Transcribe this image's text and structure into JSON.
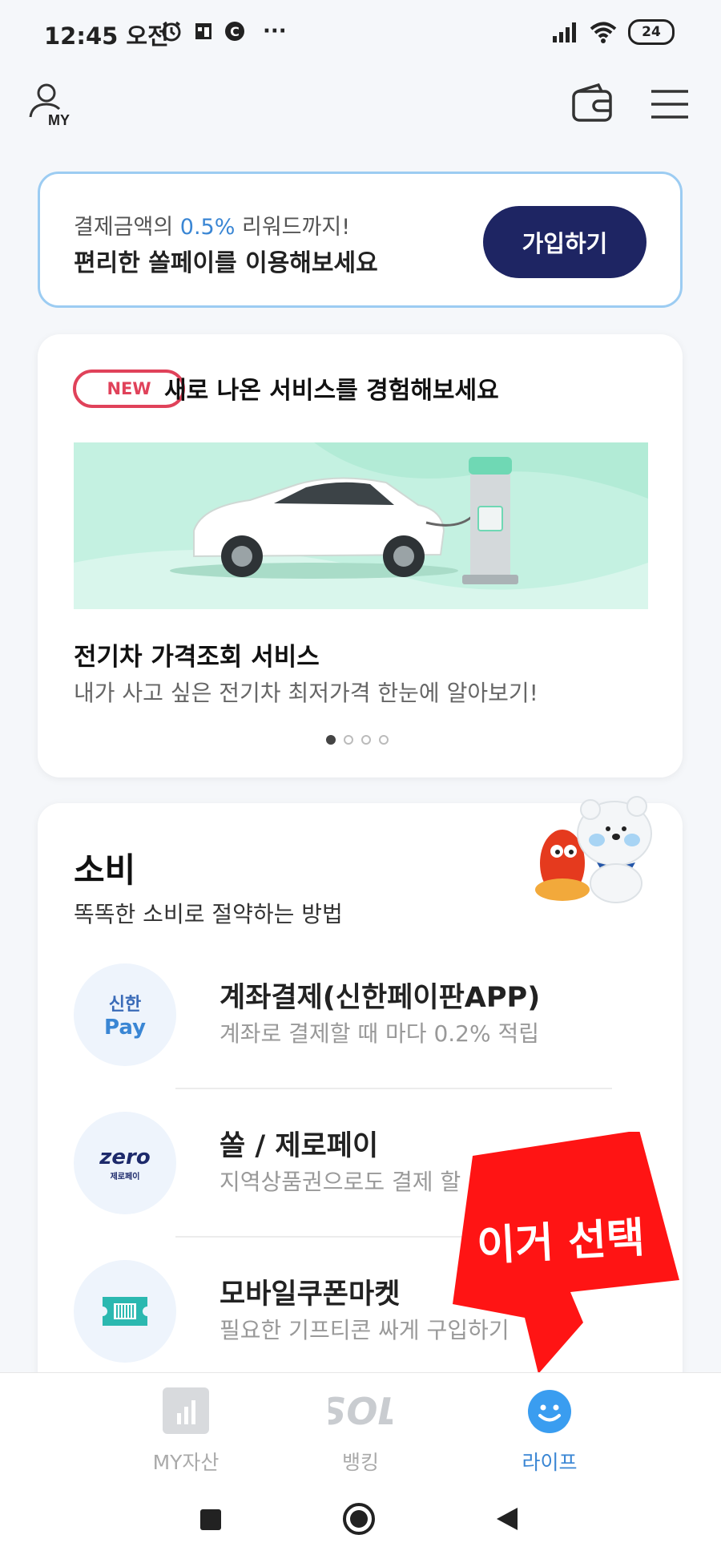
{
  "status_bar": {
    "time": "12:45 오전",
    "more": "···",
    "battery": "24"
  },
  "header": {
    "my_label": "MY"
  },
  "promo": {
    "line1_prefix": "결제금액의 ",
    "line1_highlight": "0.5%",
    "line1_suffix": " 리워드까지!",
    "line2": "편리한 쏠페이를 이용해보세요",
    "join_label": "가입하기"
  },
  "new_services": {
    "badge": "NEW",
    "title": "새로 나온 서비스를 경험해보세요",
    "item_title": "전기차 가격조회 서비스",
    "item_subtitle": "내가 사고 싶은 전기차 최저가격 한눈에 알아보기!",
    "page_count": 4,
    "current_page": 1
  },
  "spending": {
    "title": "소비",
    "subtitle": "똑똑한 소비로 절약하는 방법",
    "items": [
      {
        "title": "계좌결제(신한페이판APP)",
        "subtitle": "계좌로 결제할 때 마다 0.2% 적립",
        "logo_line1": "신한",
        "logo_line2": "Pay"
      },
      {
        "title": "쏠 / 제로페이",
        "subtitle": "지역상품권으로도 결제 할",
        "logo_line1": "zero",
        "logo_line2": "제로페이"
      },
      {
        "title": "모바일쿠폰마켓",
        "subtitle": "필요한 기프티콘 싸게 구입하기"
      }
    ]
  },
  "annotation": {
    "text": "이거 선택",
    "color": "#ff1a1a"
  },
  "bottom_nav": {
    "items": [
      {
        "label": "MY자산",
        "active": false
      },
      {
        "label": "뱅킹",
        "active": false,
        "logo": "SOL"
      },
      {
        "label": "라이프",
        "active": true
      }
    ],
    "active_color": "#3a86d4",
    "inactive_color": "#aaaaaa"
  }
}
